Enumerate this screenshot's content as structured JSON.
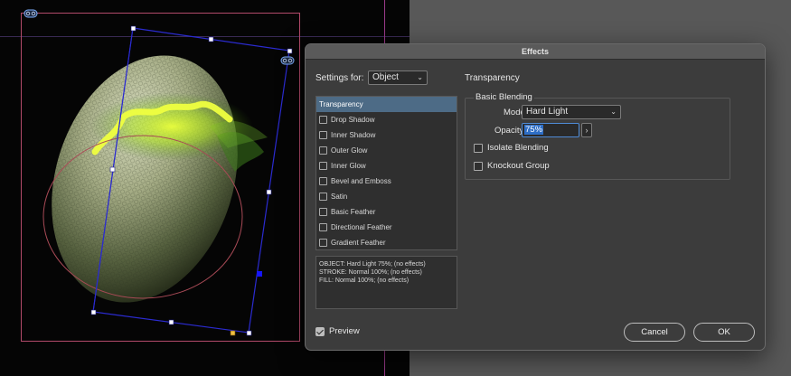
{
  "dialog": {
    "title": "Effects",
    "settings_for_label": "Settings for:",
    "settings_for_value": "Object",
    "effects": [
      {
        "label": "Transparency",
        "selected": true,
        "has_checkbox": false
      },
      {
        "label": "Drop Shadow",
        "selected": false,
        "has_checkbox": true
      },
      {
        "label": "Inner Shadow",
        "selected": false,
        "has_checkbox": true
      },
      {
        "label": "Outer Glow",
        "selected": false,
        "has_checkbox": true
      },
      {
        "label": "Inner Glow",
        "selected": false,
        "has_checkbox": true
      },
      {
        "label": "Bevel and Emboss",
        "selected": false,
        "has_checkbox": true
      },
      {
        "label": "Satin",
        "selected": false,
        "has_checkbox": true
      },
      {
        "label": "Basic Feather",
        "selected": false,
        "has_checkbox": true
      },
      {
        "label": "Directional Feather",
        "selected": false,
        "has_checkbox": true
      },
      {
        "label": "Gradient Feather",
        "selected": false,
        "has_checkbox": true
      }
    ],
    "summary": [
      "OBJECT: Hard Light 75%; (no effects)",
      "STROKE: Normal 100%; (no effects)",
      "FILL: Normal 100%; (no effects)"
    ],
    "preview_label": "Preview",
    "preview_checked": true,
    "panel": {
      "title": "Transparency",
      "group_title": "Basic Blending",
      "mode_label": "Mode:",
      "mode_value": "Hard Light",
      "opacity_label": "Opacity:",
      "opacity_value": "75%",
      "isolate_label": "Isolate Blending",
      "knockout_label": "Knockout Group"
    },
    "cancel_label": "Cancel",
    "ok_label": "OK"
  },
  "icons": {
    "dropdown": "chevron-down-icon",
    "stepper": "chevron-right-icon",
    "link": "link-icon"
  },
  "colors": {
    "selection_frame": "#2b2bd0",
    "page_border": "#b24a6a",
    "list_selected": "#4d6b86",
    "focus": "#4f8bd6"
  }
}
